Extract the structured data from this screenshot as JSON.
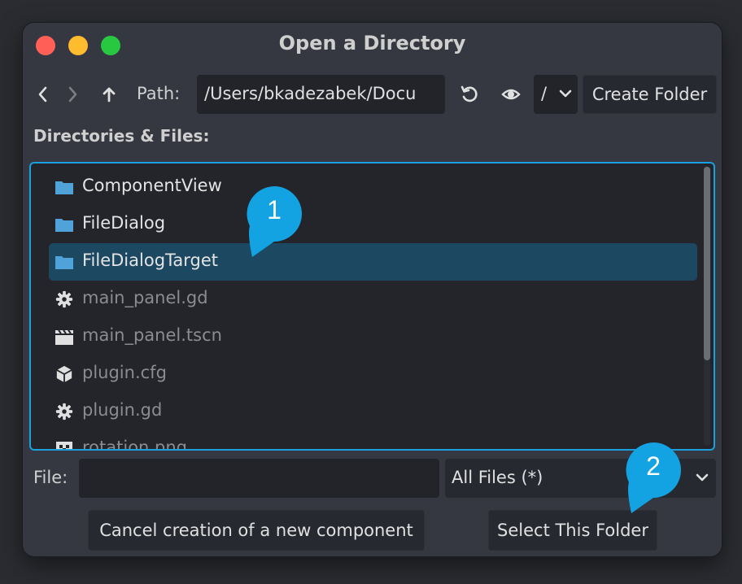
{
  "window": {
    "title": "Open a Directory"
  },
  "toolbar": {
    "back_icon": "chevron-left-icon",
    "forward_icon": "chevron-right-icon",
    "up_icon": "arrow-up-icon",
    "path_label": "Path:",
    "path_value": "/Users/bkadezabek/Docu",
    "refresh_icon": "refresh-icon",
    "hidden_toggle_icon": "eye-icon",
    "drive_value": "/",
    "create_folder_label": "Create Folder"
  },
  "list": {
    "section_label": "Directories & Files:",
    "items": [
      {
        "name": "ComponentView",
        "kind": "folder",
        "icon": "folder-icon"
      },
      {
        "name": "FileDialog",
        "kind": "folder",
        "icon": "folder-icon"
      },
      {
        "name": "FileDialogTarget",
        "kind": "folder",
        "icon": "folder-icon",
        "selected": true
      },
      {
        "name": "main_panel.gd",
        "kind": "file",
        "icon": "gear-icon"
      },
      {
        "name": "main_panel.tscn",
        "kind": "file",
        "icon": "clapperboard-icon"
      },
      {
        "name": "plugin.cfg",
        "kind": "file",
        "icon": "cube-icon"
      },
      {
        "name": "plugin.gd",
        "kind": "file",
        "icon": "gear-icon"
      },
      {
        "name": "rotation.png",
        "kind": "file",
        "icon": "image-icon"
      }
    ]
  },
  "footer": {
    "file_label": "File:",
    "file_value": "",
    "filter_value": "All Files (*)",
    "cancel_label": "Cancel creation of a new component",
    "select_label": "Select This Folder"
  },
  "annotations": [
    {
      "label": "1"
    },
    {
      "label": "2"
    }
  ],
  "colors": {
    "accent": "#1aa0de",
    "selection": "#1c4862",
    "folder": "#4fa3d9",
    "marker": "#14a3e2"
  }
}
